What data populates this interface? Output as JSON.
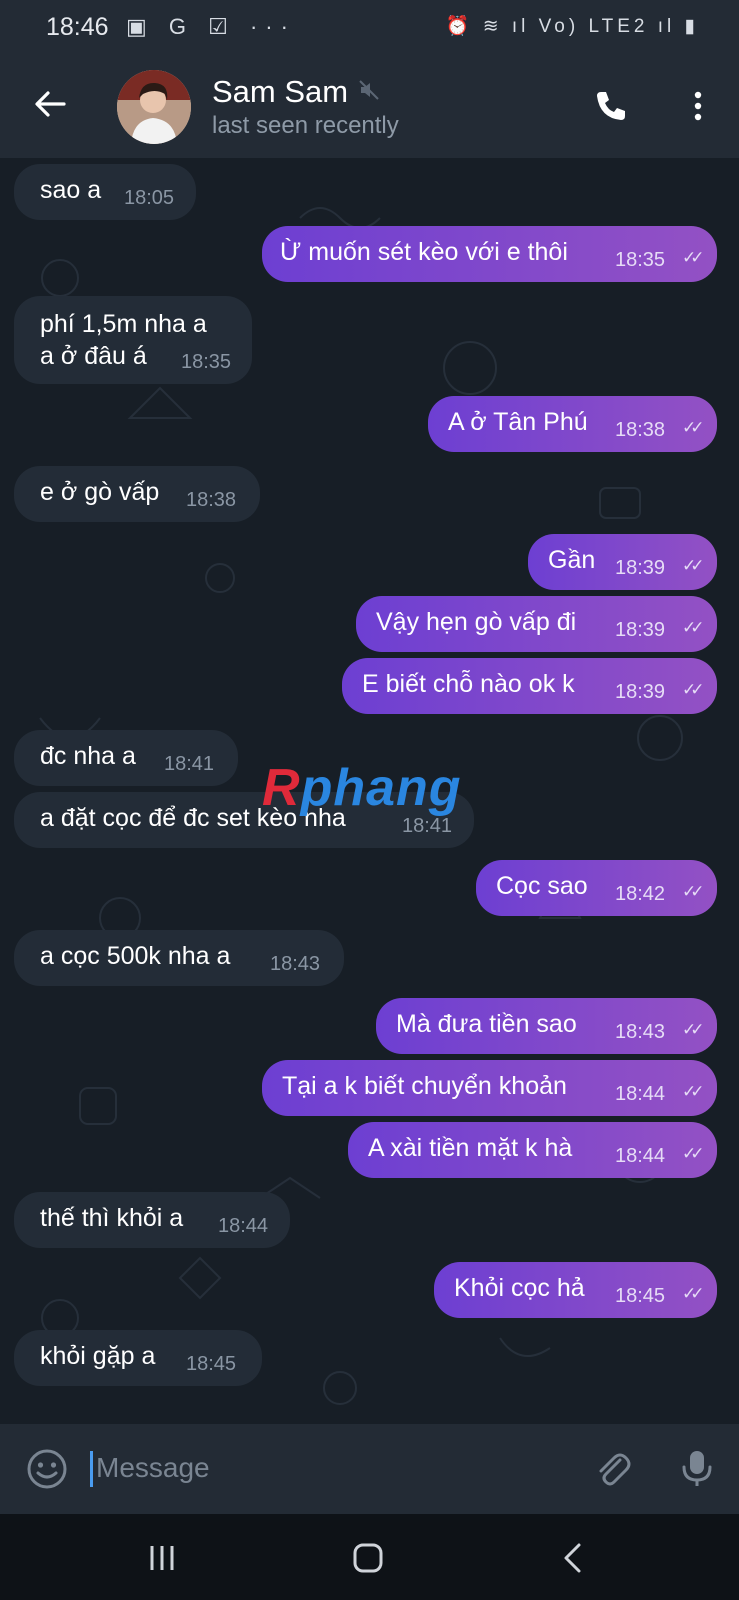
{
  "status": {
    "time": "18:46",
    "left_icons": "▣ G ☑ ···",
    "right_icons": "⏰ ≋ ıl Vo) LTE2 ıl ▮"
  },
  "header": {
    "name": "Sam Sam",
    "last_seen": "last seen recently"
  },
  "watermark": {
    "part1": "R",
    "part2": "phang"
  },
  "messages": [
    {
      "dir": "in",
      "text": "sao a",
      "time": "18:05"
    },
    {
      "dir": "out",
      "text": "Ừ muốn sét kèo với e thôi",
      "time": "18:35"
    },
    {
      "dir": "in",
      "text": "phí 1,5m nha a\na ở đâu á",
      "time": "18:35"
    },
    {
      "dir": "out",
      "text": "A ở Tân Phú",
      "time": "18:38"
    },
    {
      "dir": "in",
      "text": "e ở gò vấp",
      "time": "18:38"
    },
    {
      "dir": "out",
      "text": "Gần",
      "time": "18:39"
    },
    {
      "dir": "out",
      "text": "Vậy hẹn gò vấp đi",
      "time": "18:39"
    },
    {
      "dir": "out",
      "text": "E biết chỗ nào ok k",
      "time": "18:39"
    },
    {
      "dir": "in",
      "text": "đc nha a",
      "time": "18:41"
    },
    {
      "dir": "in",
      "text": "a đặt cọc để đc set kèo nha",
      "time": "18:41"
    },
    {
      "dir": "out",
      "text": "Cọc sao",
      "time": "18:42"
    },
    {
      "dir": "in",
      "text": "a cọc 500k nha a",
      "time": "18:43"
    },
    {
      "dir": "out",
      "text": "Mà đưa tiền sao",
      "time": "18:43"
    },
    {
      "dir": "out",
      "text": "Tại a k biết chuyển khoản",
      "time": "18:44"
    },
    {
      "dir": "out",
      "text": "A xài tiền mặt k hà",
      "time": "18:44"
    },
    {
      "dir": "in",
      "text": "thế thì khỏi a",
      "time": "18:44"
    },
    {
      "dir": "out",
      "text": "Khỏi cọc hả",
      "time": "18:45"
    },
    {
      "dir": "in",
      "text": "khỏi gặp a",
      "time": "18:45"
    }
  ],
  "input": {
    "placeholder": "Message"
  },
  "checkmark": "✓✓",
  "colors": {
    "header_bg": "#232b35",
    "chat_bg": "#171e26",
    "incoming": "#232c37",
    "outgoing": "#8952c8"
  }
}
